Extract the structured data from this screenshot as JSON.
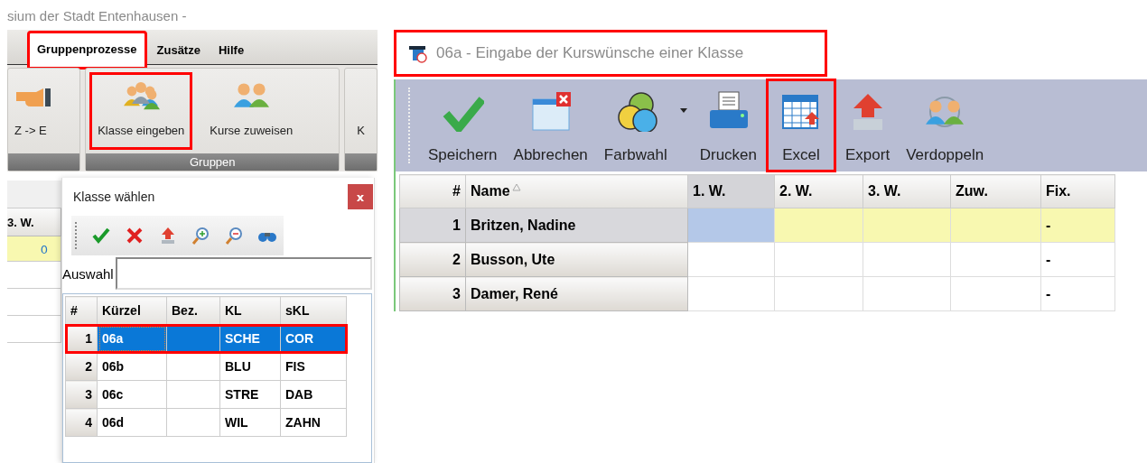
{
  "main_window": {
    "title": "sium der Stadt Entenhausen -",
    "tabs": [
      {
        "label": "Gruppenprozesse",
        "selected": true,
        "highlighted": true
      },
      {
        "label": "Zusätze",
        "selected": false,
        "highlighted": false
      },
      {
        "label": "Hilfe",
        "selected": false,
        "highlighted": false
      }
    ],
    "ribbon_groups": [
      {
        "buttons": [
          {
            "label": "Z -> E",
            "highlighted": false
          }
        ]
      },
      {
        "label": "Gruppen",
        "buttons": [
          {
            "label": "Klasse eingeben",
            "highlighted": true
          },
          {
            "label": "Kurse zuweisen",
            "highlighted": false
          }
        ]
      },
      {
        "buttons": [
          {
            "label": "K",
            "highlighted": false
          }
        ]
      }
    ],
    "grid": {
      "column_1": "3. W.",
      "rows": [
        {
          "value": "0",
          "selected": true
        },
        {
          "value": "",
          "selected": false
        },
        {
          "value": "",
          "selected": false
        },
        {
          "value": "",
          "selected": false
        }
      ]
    }
  },
  "class_dialog": {
    "title": "Klasse wählen",
    "close": "x",
    "filter": {
      "label": "Auswahl"
    },
    "columns": [
      "#",
      "Kürzel",
      "Bez.",
      "KL",
      "sKL"
    ],
    "rows": [
      {
        "cells": [
          "1",
          "06a",
          "",
          "SCHE",
          "COR"
        ],
        "selected": true,
        "highlighted": true
      },
      {
        "cells": [
          "2",
          "06b",
          "",
          "BLU",
          "FIS"
        ],
        "selected": false,
        "highlighted": false
      },
      {
        "cells": [
          "3",
          "06c",
          "",
          "STRE",
          "DAB"
        ],
        "selected": false,
        "highlighted": false
      },
      {
        "cells": [
          "4",
          "06d",
          "",
          "WIL",
          "ZAHN"
        ],
        "selected": false,
        "highlighted": false
      }
    ]
  },
  "course_window": {
    "title": "06a - Eingabe der Kurswünsche einer Klasse",
    "title_highlighted": true,
    "toolbar": [
      {
        "label": "Speichern",
        "highlighted": false,
        "dropdown": false
      },
      {
        "label": "Abbrechen",
        "highlighted": false,
        "dropdown": false
      },
      {
        "label": "Farbwahl",
        "highlighted": false,
        "dropdown": true
      },
      {
        "label": "Drucken",
        "highlighted": false,
        "dropdown": false
      },
      {
        "label": "Excel",
        "highlighted": true,
        "dropdown": false
      },
      {
        "label": "Export",
        "highlighted": false,
        "dropdown": false
      },
      {
        "label": "Verdoppeln",
        "highlighted": false,
        "dropdown": false
      }
    ],
    "columns": [
      {
        "label": "#",
        "selected": false,
        "sorted": false
      },
      {
        "label": "Name",
        "selected": false,
        "sorted": true
      },
      {
        "label": "1. W.",
        "selected": true,
        "sorted": false
      },
      {
        "label": "2. W.",
        "selected": false,
        "sorted": false
      },
      {
        "label": "3. W.",
        "selected": false,
        "sorted": false
      },
      {
        "label": "Zuw.",
        "selected": false,
        "sorted": false
      },
      {
        "label": "Fix.",
        "selected": false,
        "sorted": false
      }
    ],
    "rows": [
      {
        "cells": [
          "1",
          "Britzen, Nadine",
          "",
          "",
          "",
          "",
          "-"
        ],
        "selected": true
      },
      {
        "cells": [
          "2",
          "Busson, Ute",
          "",
          "",
          "",
          "",
          "-"
        ],
        "selected": false
      },
      {
        "cells": [
          "3",
          "Damer, René",
          "",
          "",
          "",
          "",
          "-"
        ],
        "selected": false
      }
    ]
  }
}
